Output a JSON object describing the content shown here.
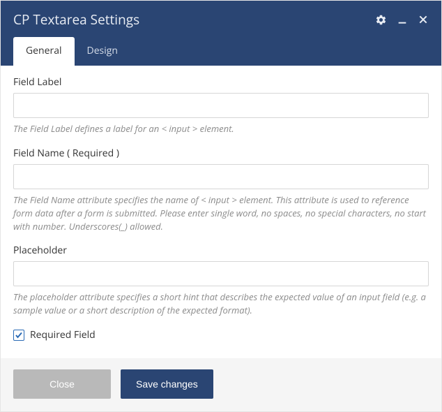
{
  "header": {
    "title": "CP Textarea Settings"
  },
  "tabs": {
    "general": "General",
    "design": "Design"
  },
  "fields": {
    "field_label": {
      "label": "Field Label",
      "value": "",
      "help": "The Field Label defines a label for an < input > element."
    },
    "field_name": {
      "label": "Field Name ( Required )",
      "value": "",
      "help": "The Field Name attribute specifies the name of < input > element. This attribute is used to reference form data after a form is submitted. Please enter single word, no spaces, no special characters, no start with number. Underscores(_) allowed."
    },
    "placeholder": {
      "label": "Placeholder",
      "value": "",
      "help": "The placeholder attribute specifies a short hint that describes the expected value of an input field (e.g. a sample value or a short description of the expected format)."
    },
    "required_field": {
      "label": "Required Field",
      "checked": true
    }
  },
  "footer": {
    "close": "Close",
    "save": "Save changes"
  }
}
